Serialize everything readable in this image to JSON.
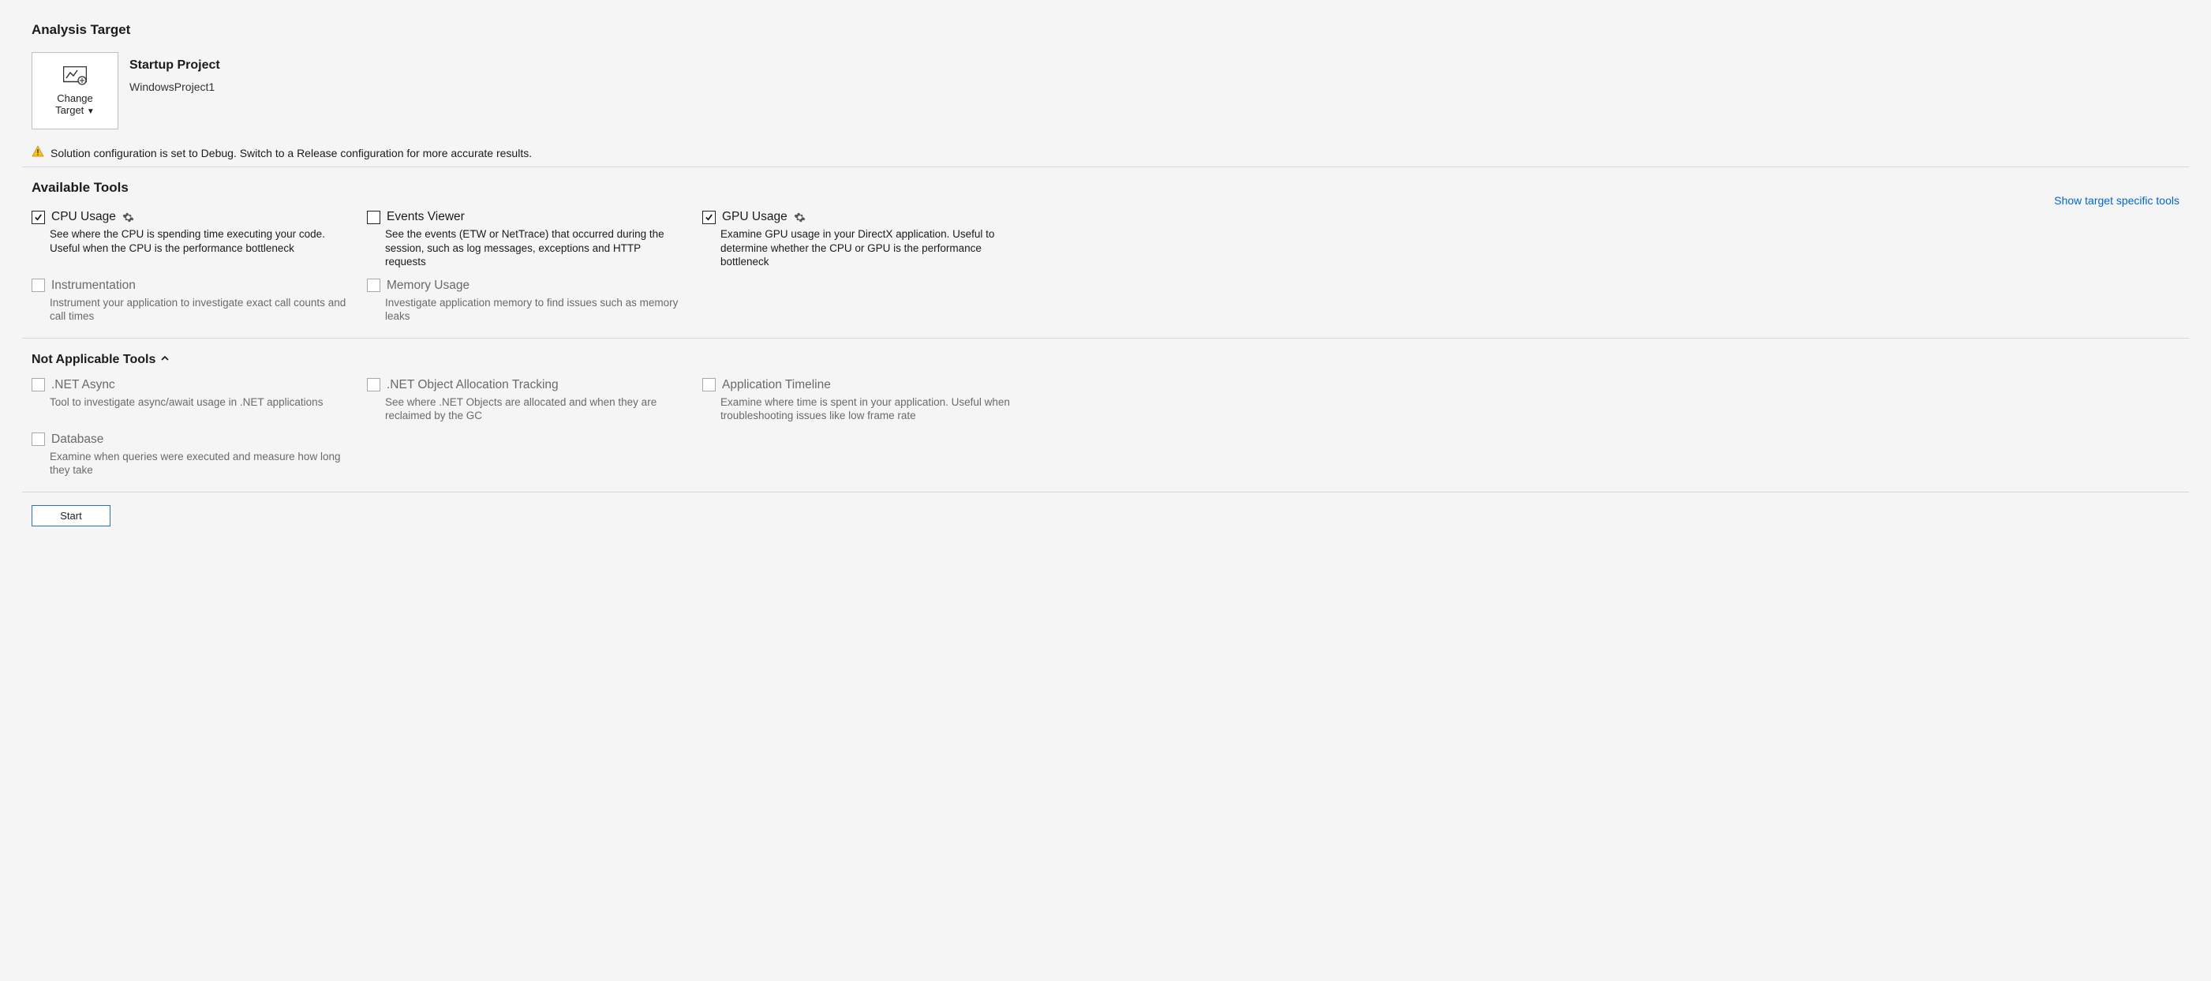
{
  "analysis_target": {
    "heading": "Analysis Target",
    "change_target_line1": "Change",
    "change_target_line2": "Target",
    "startup_project_label": "Startup Project",
    "startup_project_name": "WindowsProject1",
    "warning_text": "Solution configuration is set to Debug. Switch to a Release configuration for more accurate results."
  },
  "available_tools": {
    "heading": "Available Tools",
    "show_specific_link": "Show target specific tools",
    "tools": [
      {
        "label": "CPU Usage",
        "checked": true,
        "has_gear": true,
        "desc": "See where the CPU is spending time executing your code. Useful when the CPU is the performance bottleneck"
      },
      {
        "label": "Events Viewer",
        "checked": false,
        "has_gear": false,
        "desc": "See the events (ETW or NetTrace) that occurred during the session, such as log messages, exceptions and HTTP requests"
      },
      {
        "label": "GPU Usage",
        "checked": true,
        "has_gear": true,
        "desc": "Examine GPU usage in your DirectX application. Useful to determine whether the CPU or GPU is the performance bottleneck"
      },
      {
        "label": "Instrumentation",
        "checked": false,
        "has_gear": false,
        "desc": "Instrument your application to investigate exact call counts and call times"
      },
      {
        "label": "Memory Usage",
        "checked": false,
        "has_gear": false,
        "desc": "Investigate application memory to find issues such as memory leaks"
      }
    ]
  },
  "not_applicable_tools": {
    "heading": "Not Applicable Tools",
    "expanded": true,
    "tools": [
      {
        "label": ".NET Async",
        "desc": "Tool to investigate async/await usage in .NET applications"
      },
      {
        "label": ".NET Object Allocation Tracking",
        "desc": "See where .NET Objects are allocated and when they are reclaimed by the GC"
      },
      {
        "label": "Application Timeline",
        "desc": "Examine where time is spent in your application. Useful when troubleshooting issues like low frame rate"
      },
      {
        "label": "Database",
        "desc": "Examine when queries were executed and measure how long they take"
      }
    ]
  },
  "start_button": "Start"
}
